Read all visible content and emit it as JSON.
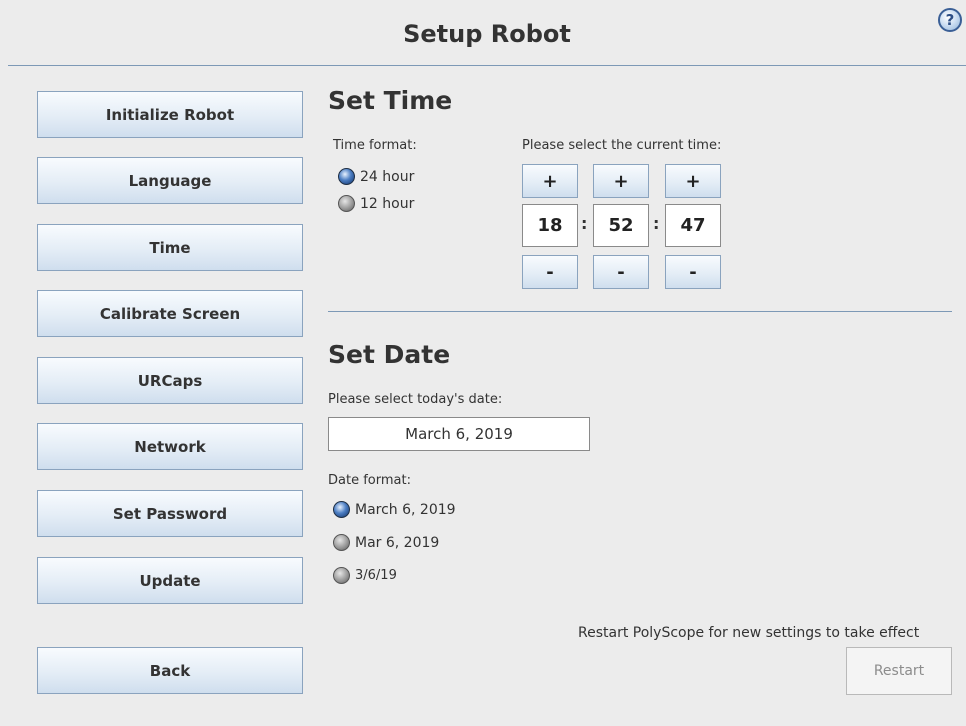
{
  "header": {
    "title": "Setup Robot",
    "help_icon": "?"
  },
  "sidebar": {
    "items": [
      {
        "label": "Initialize Robot"
      },
      {
        "label": "Language"
      },
      {
        "label": "Time"
      },
      {
        "label": "Calibrate Screen"
      },
      {
        "label": "URCaps"
      },
      {
        "label": "Network"
      },
      {
        "label": "Set Password"
      },
      {
        "label": "Update"
      }
    ],
    "back_label": "Back"
  },
  "set_time": {
    "heading": "Set Time",
    "format_label": "Time format:",
    "format_options": [
      {
        "label": "24 hour",
        "selected": true
      },
      {
        "label": "12 hour",
        "selected": false
      }
    ],
    "select_label": "Please select the current time:",
    "plus": "+",
    "minus": "-",
    "separator": ":",
    "hours": "18",
    "minutes": "52",
    "seconds": "47"
  },
  "set_date": {
    "heading": "Set Date",
    "select_label": "Please select today's date:",
    "value": "March 6, 2019",
    "format_label": "Date format:",
    "format_options": [
      {
        "label": "March 6, 2019",
        "selected": true
      },
      {
        "label": "Mar 6, 2019",
        "selected": false
      },
      {
        "label": "3/6/19",
        "selected": false
      }
    ]
  },
  "footer": {
    "restart_note": "Restart PolyScope for new settings to take effect",
    "restart_label": "Restart",
    "restart_enabled": false
  }
}
